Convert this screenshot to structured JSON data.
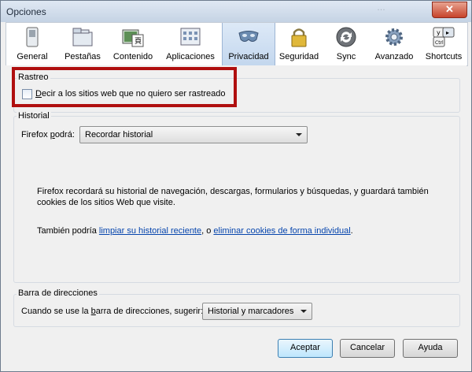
{
  "window": {
    "title": "Opciones",
    "ghost_text": "…",
    "close_label": "✕"
  },
  "tabs": [
    {
      "label": "General",
      "icon": "general-switch-icon"
    },
    {
      "label": "Pestañas",
      "icon": "tabs-icon"
    },
    {
      "label": "Contenido",
      "icon": "content-icon"
    },
    {
      "label": "Aplicaciones",
      "icon": "applications-icon"
    },
    {
      "label": "Privacidad",
      "icon": "privacy-mask-icon",
      "active": true
    },
    {
      "label": "Seguridad",
      "icon": "padlock-icon"
    },
    {
      "label": "Sync",
      "icon": "sync-icon"
    },
    {
      "label": "Avanzado",
      "icon": "gear-icon"
    },
    {
      "label": "Shortcuts",
      "icon": "keyboard-shortcuts-icon"
    }
  ],
  "tracking": {
    "group_label": "Rastreo",
    "checkbox_label_first": "D",
    "checkbox_label_rest": "ecir a los sitios web que no quiero ser rastreado",
    "checked": false
  },
  "history": {
    "group_label": "Historial",
    "label_a": "Firefox ",
    "label_b": "p",
    "label_c": "odrá:",
    "select_value": "Recordar historial",
    "desc_line1": "Firefox recordará su historial de navegación, descargas, formularios y búsquedas, y guardará también",
    "desc_line2": "cookies de los sitios Web que visite.",
    "also_prefix": "También podría ",
    "link1": "limpiar su historial reciente",
    "also_mid": ", o ",
    "link2": "eliminar cookies de forma individual",
    "also_suffix": "."
  },
  "addressbar": {
    "group_label": "Barra de direcciones",
    "label_a": "Cuando se use la ",
    "label_b": "b",
    "label_c": "arra de direcciones, sugerir:",
    "select_value": "Historial y marcadores"
  },
  "buttons": {
    "accept": "Aceptar",
    "cancel": "Cancelar",
    "help": "Ayuda"
  },
  "colors": {
    "highlight": "#b00f0f",
    "link": "#0645ad",
    "active_tab": "#c3d7ee"
  }
}
